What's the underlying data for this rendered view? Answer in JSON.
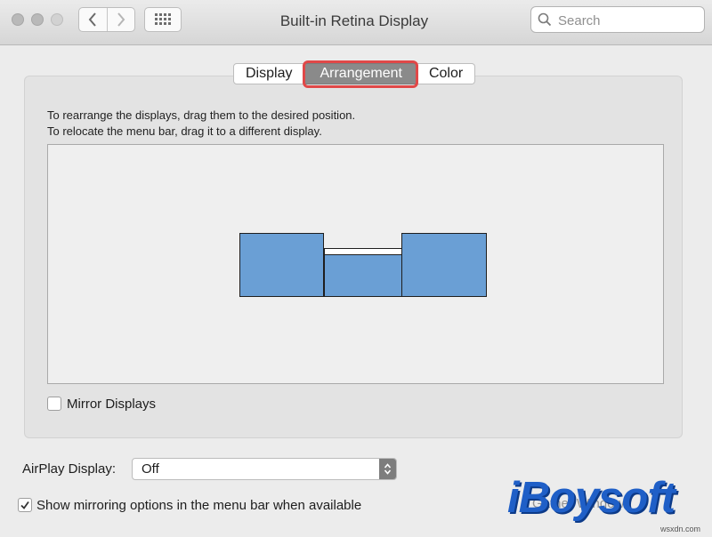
{
  "window": {
    "title": "Built-in Retina Display"
  },
  "toolbar": {
    "back_icon": "chevron-left-icon",
    "forward_icon": "chevron-right-icon",
    "show_all_icon": "grid-icon"
  },
  "search": {
    "placeholder": "Search"
  },
  "tabs": [
    {
      "label": "Display",
      "selected": false
    },
    {
      "label": "Arrangement",
      "selected": true
    },
    {
      "label": "Color",
      "selected": false
    }
  ],
  "instructions": {
    "line1": "To rearrange the displays, drag them to the desired position.",
    "line2": "To relocate the menu bar, drag it to a different display."
  },
  "displays": [
    {
      "label": "left-display",
      "has_menu_bar": false
    },
    {
      "label": "center-display",
      "has_menu_bar": true
    },
    {
      "label": "right-display",
      "has_menu_bar": false
    }
  ],
  "mirror_displays": {
    "label": "Mirror Displays",
    "checked": false
  },
  "airplay": {
    "label": "AirPlay Display:",
    "value": "Off"
  },
  "show_mirroring": {
    "label": "Show mirroring options in the menu bar when available",
    "checked": true
  },
  "hidden_button": {
    "label": "Gather Windows"
  },
  "watermark": {
    "logo": "iBoysoft",
    "site": "wsxdn.com"
  },
  "colors": {
    "display_fill": "#6a9fd5",
    "highlight": "#e04848",
    "selected_tab": "#8a8a8a",
    "logo": "#1f5fc7"
  }
}
